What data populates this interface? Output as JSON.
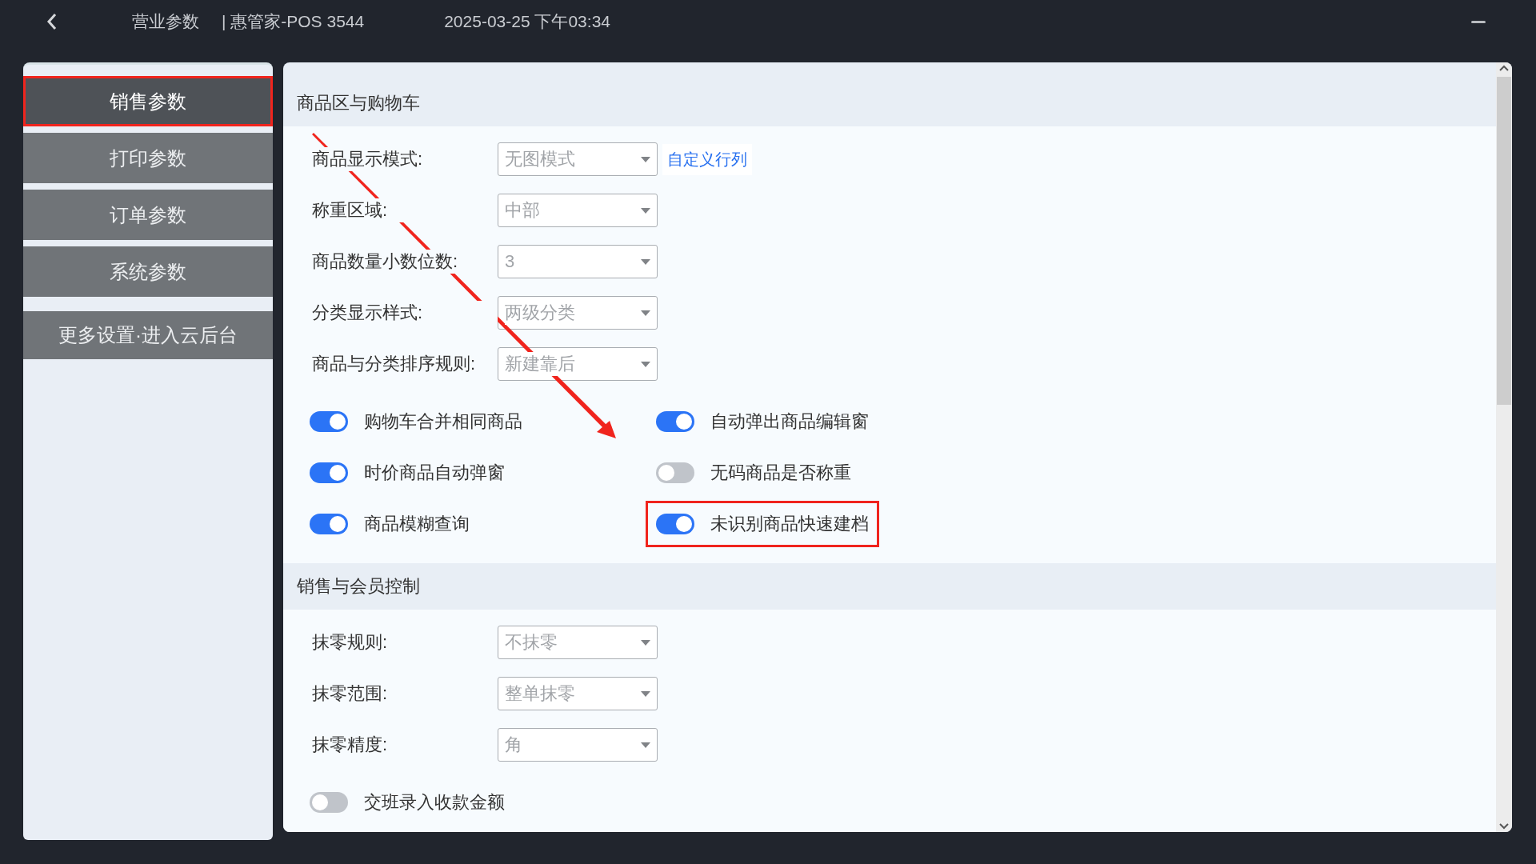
{
  "window": {
    "title": "营业参数",
    "device": "| 惠管家-POS 3544",
    "datetime": "2025-03-25 下午03:34"
  },
  "sidebar": {
    "items": [
      {
        "label": "销售参数",
        "selected": true,
        "highlighted": true
      },
      {
        "label": "打印参数",
        "selected": false,
        "highlighted": false
      },
      {
        "label": "订单参数",
        "selected": false,
        "highlighted": false
      },
      {
        "label": "系统参数",
        "selected": false,
        "highlighted": false
      },
      {
        "label": "更多设置·进入云后台",
        "selected": false,
        "highlighted": false
      }
    ]
  },
  "sections": [
    {
      "title": "商品区与购物车",
      "fields": [
        {
          "label": "商品显示模式:",
          "value": "无图模式",
          "link": "自定义行列"
        },
        {
          "label": "称重区域:",
          "value": "中部"
        },
        {
          "label": "商品数量小数位数:",
          "value": "3"
        },
        {
          "label": "分类显示样式:",
          "value": "两级分类"
        },
        {
          "label": "商品与分类排序规则:",
          "value": "新建靠后"
        }
      ],
      "switches": [
        {
          "label": "购物车合并相同商品",
          "on": true,
          "highlighted": false
        },
        {
          "label": "自动弹出商品编辑窗",
          "on": true,
          "highlighted": false
        },
        {
          "label": "时价商品自动弹窗",
          "on": true,
          "highlighted": false
        },
        {
          "label": "无码商品是否称重",
          "on": false,
          "highlighted": false
        },
        {
          "label": "商品模糊查询",
          "on": true,
          "highlighted": false
        },
        {
          "label": "未识别商品快速建档",
          "on": true,
          "highlighted": true
        }
      ]
    },
    {
      "title": "销售与会员控制",
      "fields": [
        {
          "label": "抹零规则:",
          "value": "不抹零"
        },
        {
          "label": "抹零范围:",
          "value": "整单抹零"
        },
        {
          "label": "抹零精度:",
          "value": "角"
        }
      ],
      "switches": [
        {
          "label": "交班录入收款金额",
          "on": false,
          "highlighted": false
        }
      ]
    }
  ]
}
